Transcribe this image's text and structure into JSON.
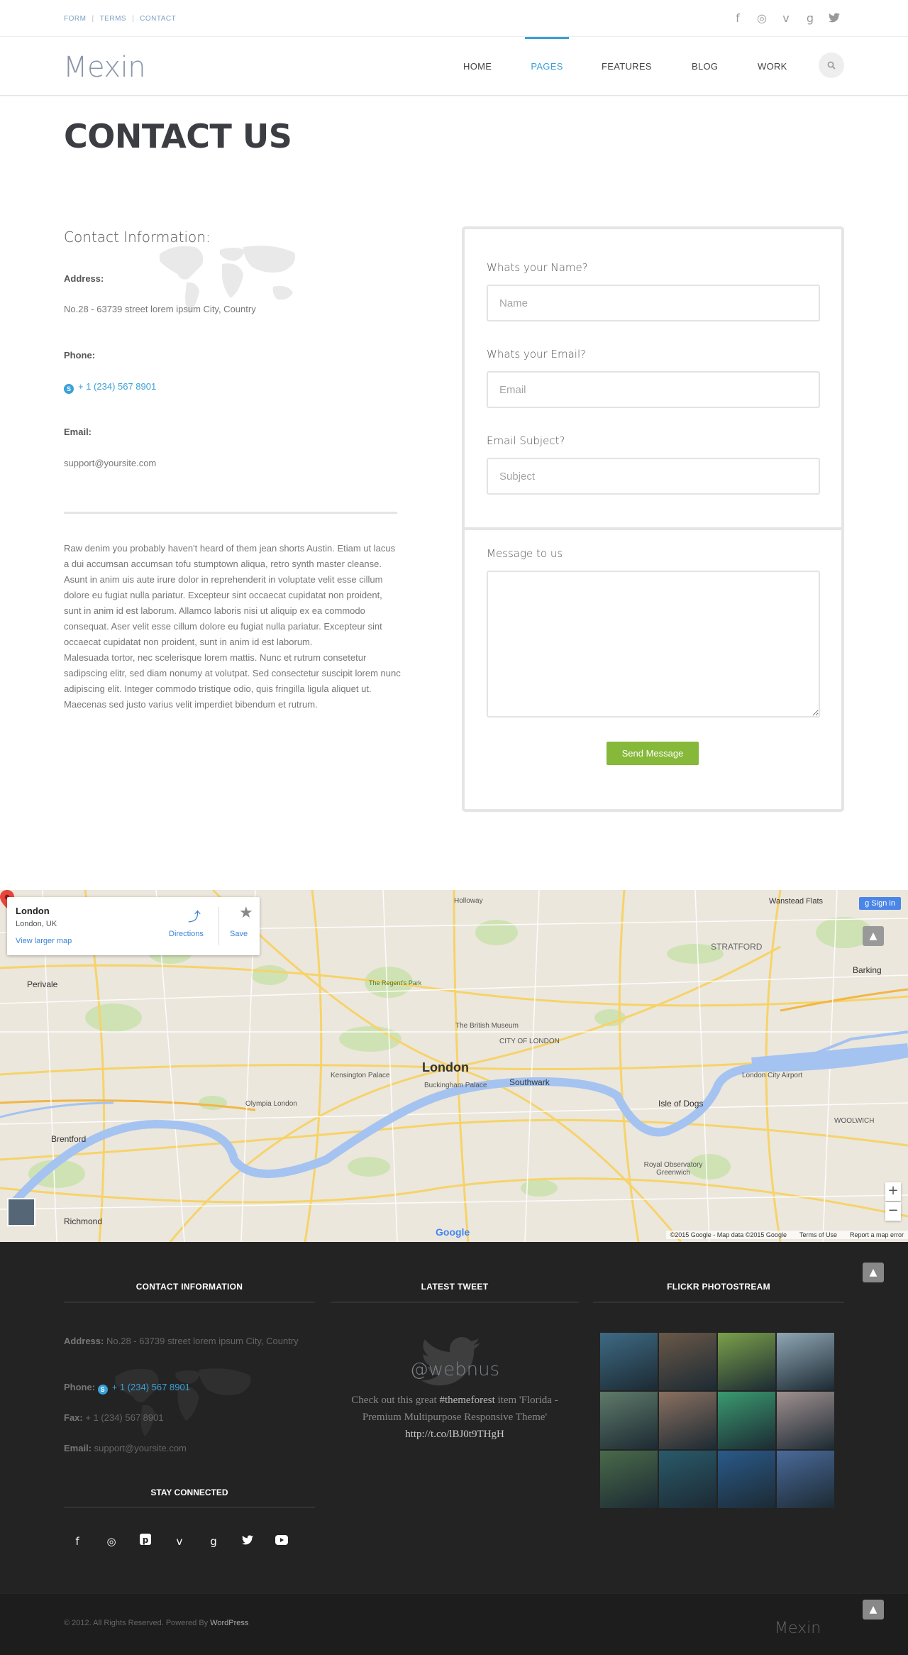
{
  "topbar": {
    "links": [
      "FORM",
      "TERMS",
      "CONTACT"
    ],
    "socials": [
      "facebook-icon",
      "dribbble-icon",
      "vimeo-icon",
      "google-plus-icon",
      "twitter-icon"
    ]
  },
  "header": {
    "logo": "Mexin",
    "nav": [
      "HOME",
      "PAGES",
      "FEATURES",
      "BLOG",
      "WORK"
    ],
    "active_nav": "PAGES",
    "accent": "#3aa1d6"
  },
  "page_title": "CONTACT US",
  "contact": {
    "heading": "Contact Information:",
    "address_label": "Address:",
    "address": "No.28 - 63739 street lorem ipsum City, Country",
    "phone_label": "Phone:",
    "phone": "+ 1 (234) 567 8901",
    "email_label": "Email:",
    "email": "support@yoursite.com",
    "paragraphs": [
      "Raw denim you probably haven't heard of them jean shorts Austin. Etiam ut lacus a dui accumsan accumsan tofu stumptown aliqua, retro synth master cleanse.",
      "Asunt in anim uis aute irure dolor in reprehenderit in voluptate velit esse cillum dolore eu fugiat nulla pariatur. Excepteur sint occaecat cupidatat non proident, sunt in anim id est laborum. Allamco laboris nisi ut aliquip ex ea commodo consequat. Aser velit esse cillum dolore eu fugiat nulla pariatur. Excepteur sint occaecat cupidatat non proident, sunt in anim id est laborum.",
      "Malesuada tortor, nec scelerisque lorem mattis. Nunc et rutrum consetetur sadipscing elitr, sed diam nonumy at volutpat. Sed consectetur suscipit lorem nunc adipiscing elit. Integer commodo tristique odio, quis fringilla ligula aliquet ut. Maecenas sed justo varius velit imperdiet bibendum et rutrum."
    ]
  },
  "form": {
    "name_label": "Whats your Name?",
    "name_placeholder": "Name",
    "email_label": "Whats your Email?",
    "email_placeholder": "Email",
    "subject_label": "Email Subject?",
    "subject_placeholder": "Subject",
    "message_label": "Message to us",
    "send_label": "Send Message",
    "send_color": "#86b83a"
  },
  "map": {
    "place_title": "London",
    "place_sub": "London, UK",
    "view_larger": "View larger map",
    "directions": "Directions",
    "save": "Save",
    "sign_in": "Sign in",
    "google": "Google",
    "attribution": "©2015 Google - Map data ©2015 Google",
    "terms": "Terms of Use",
    "report": "Report a map error",
    "labels": {
      "london": "London",
      "holloway": "Holloway",
      "stratford": "STRATFORD",
      "barking": "Barking",
      "perivale": "Perivale",
      "british_museum": "The British Museum",
      "kensington": "Kensington Palace",
      "buckingham": "Buckingham Palace",
      "southwark": "Southwark",
      "isle_of_dogs": "Isle of Dogs",
      "city_airport": "London City Airport",
      "brentford": "Brentford",
      "richmond": "Richmond",
      "royal_obs": "Royal Observatory Greenwich",
      "olympia": "Olympia London",
      "city_of_london": "CITY OF LONDON",
      "wanstead": "Wanstead Flats",
      "woolwich": "WOOLWICH",
      "regents": "The Regent's Park"
    }
  },
  "footer": {
    "col1_title": "CONTACT INFORMATION",
    "col2_title": "LATEST TWEET",
    "col3_title": "FLICKR PHOTOSTREAM",
    "address_label": "Address:",
    "address": "No.28 - 63739 street lorem ipsum City, Country",
    "phone_label": "Phone:",
    "phone": "+ 1 (234) 567 8901",
    "fax_label": "Fax:",
    "fax": "+ 1 (234) 567 8901",
    "email_label": "Email:",
    "email": "support@yoursite.com",
    "stay_connected": "STAY CONNECTED",
    "socials": [
      "facebook-icon",
      "dribbble-icon",
      "pinterest-icon",
      "vimeo-icon",
      "google-plus-icon",
      "twitter-icon",
      "youtube-icon"
    ],
    "tweet_handle": "@webnus",
    "tweet_pre": "Check out this great ",
    "tweet_hash": "#themeforest",
    "tweet_mid": " item 'Florida - Premium Multipurpose Responsive Theme'",
    "tweet_link": "http://t.co/lBJ0t9THgH",
    "flickr_colors": [
      "#3e6a84",
      "#6a5848",
      "#7aa04a",
      "#8fa6b4",
      "#5f7a6a",
      "#8a7060",
      "#3a9a70",
      "#a09090",
      "#4a6a4a",
      "#2a5a6a",
      "#2a5a8a",
      "#4a6a9a"
    ],
    "copyright": "© 2012. All Rights Reserved. Powered By",
    "powered_by": "WordPress",
    "logo": "Mexin"
  }
}
